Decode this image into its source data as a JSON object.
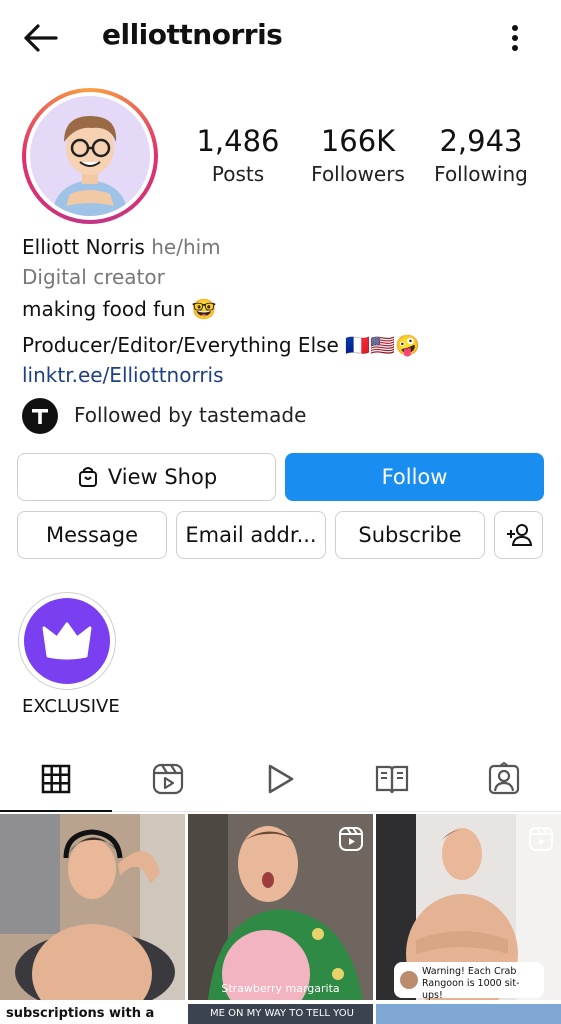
{
  "header": {
    "username": "elliottnorris",
    "back_icon": "arrow-left-icon",
    "more_icon": "vertical-dots-icon"
  },
  "stats": [
    {
      "value": "1,486",
      "label": "Posts"
    },
    {
      "value": "166K",
      "label": "Followers"
    },
    {
      "value": "2,943",
      "label": "Following"
    }
  ],
  "bio": {
    "name": "Elliott Norris",
    "pronouns": "he/him",
    "category": "Digital creator",
    "line1": "making food fun 🤓",
    "line2": "Producer/Editor/Everything Else 🇫🇷🇺🇸🤪",
    "link": "linktr.ee/Elliottnorris"
  },
  "followed_by": "Followed by tastemade",
  "buttons": {
    "view_shop": "View Shop",
    "follow": "Follow",
    "message": "Message",
    "email": "Email addr...",
    "subscribe": "Subscribe"
  },
  "highlight": {
    "label": "EXCLUSIVE",
    "icon": "crown-icon"
  },
  "tabs": [
    {
      "icon": "grid-icon",
      "active": true
    },
    {
      "icon": "reels-icon",
      "active": false
    },
    {
      "icon": "play-icon",
      "active": false
    },
    {
      "icon": "guide-book-icon",
      "active": false
    },
    {
      "icon": "tagged-person-icon",
      "active": false
    }
  ],
  "posts": [
    {
      "caption": ""
    },
    {
      "caption": "Strawberry margarita"
    },
    {
      "caption": "Warning! Each Crab Rangoon is 1000 sit-ups!"
    }
  ],
  "posts_row2": [
    {
      "caption": "subscriptions with a"
    },
    {
      "caption": "ME ON MY WAY TO TELL YOU"
    },
    {
      "caption": ""
    }
  ],
  "colors": {
    "follow_blue": "#1a8ef0",
    "link_blue": "#1f3f86",
    "highlight_purple": "#7b3ff2"
  }
}
